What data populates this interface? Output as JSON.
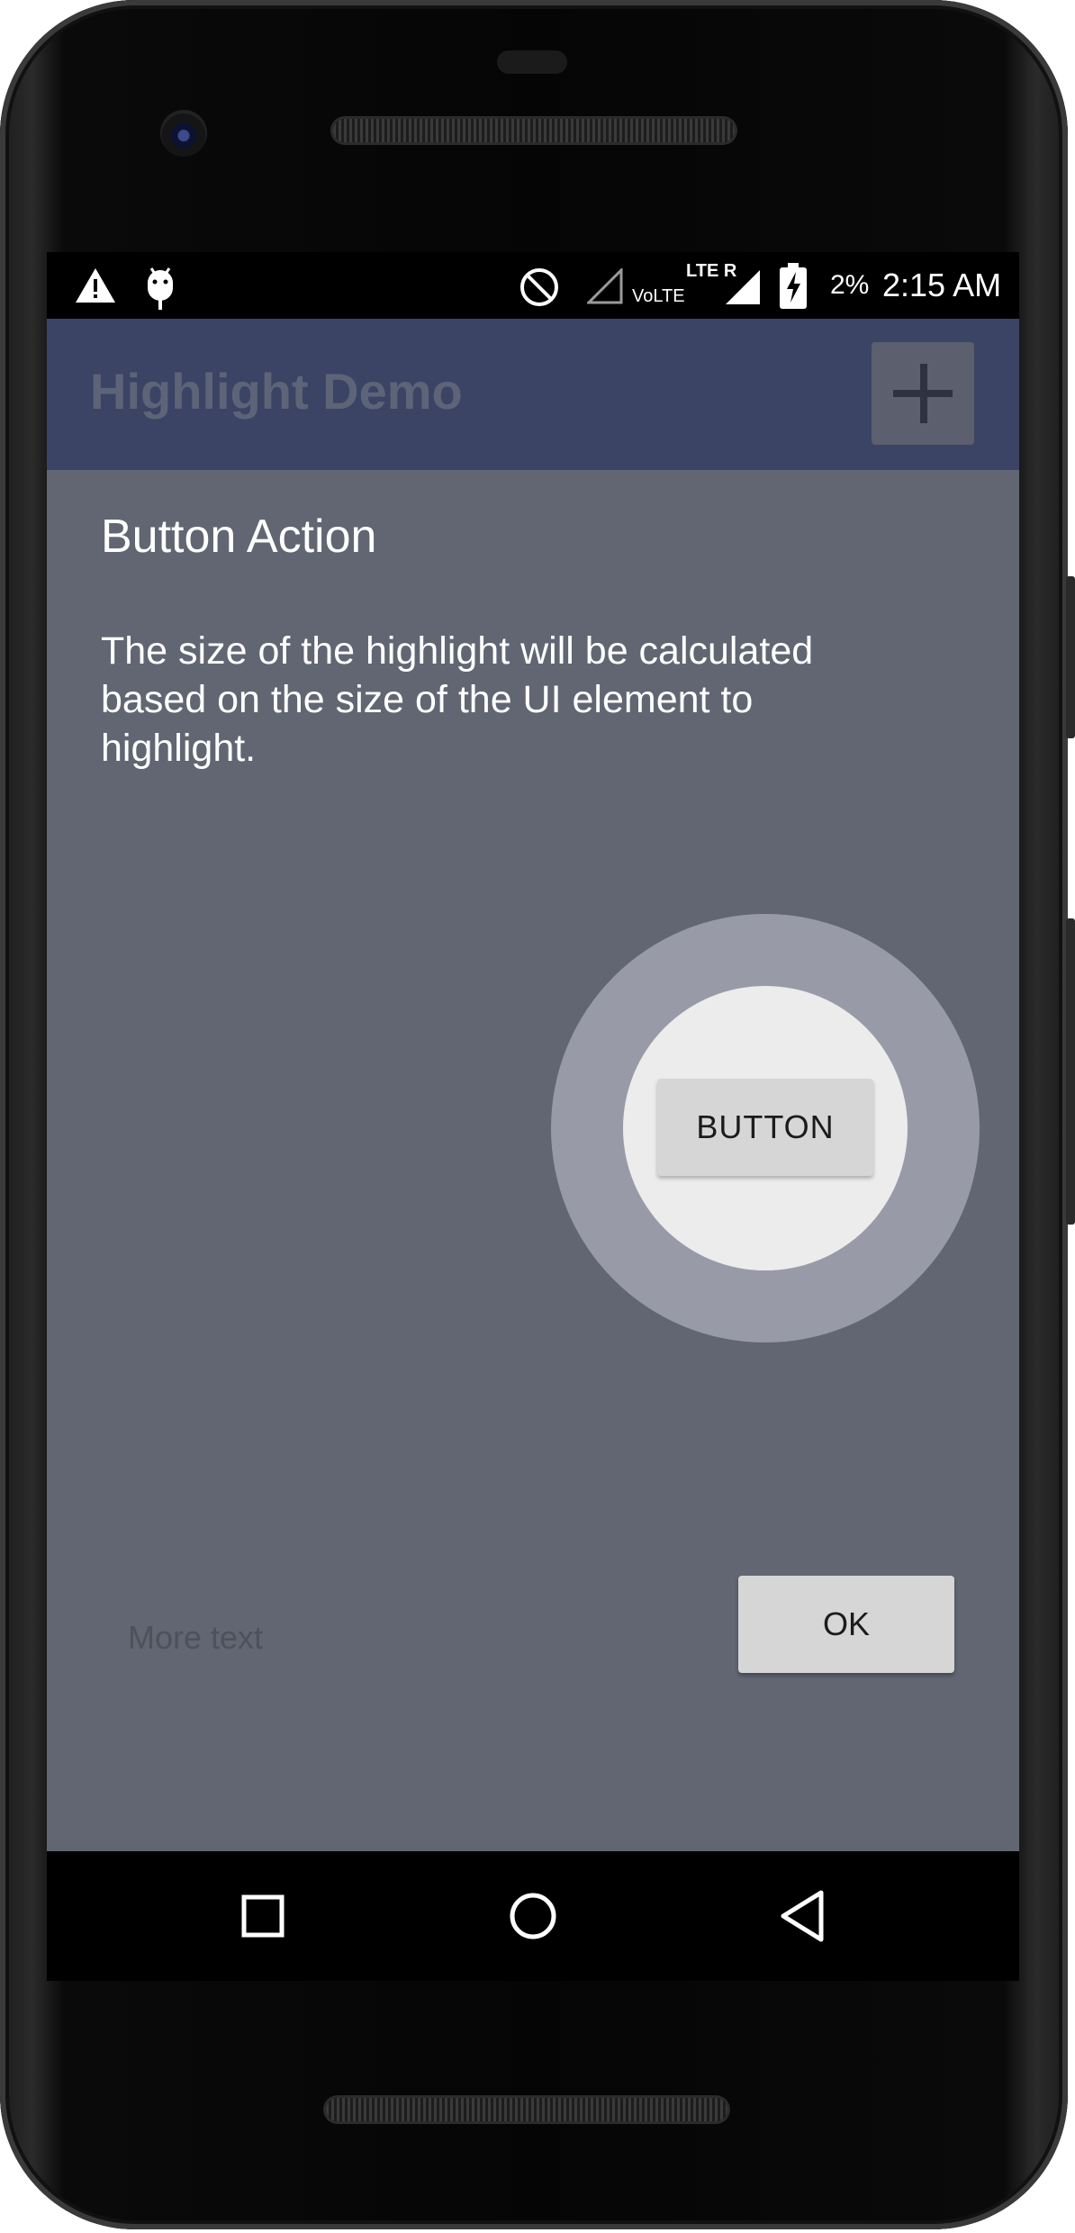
{
  "status_bar": {
    "battery_percent": "2%",
    "time": "2:15 AM",
    "volte_label": "VoLTE",
    "lte_label": "LTE R",
    "icons": [
      "warning-icon",
      "android-debug-icon",
      "do-not-disturb-icon",
      "signal-volte-icon",
      "signal-lte-icon",
      "battery-charging-icon"
    ]
  },
  "app_bar": {
    "title": "Highlight Demo",
    "action_icon": "add-icon"
  },
  "overlay": {
    "title": "Button Action",
    "description": "The size of the highlight will be calculated based on the size of the UI element to highlight.",
    "highlighted_button_label": "BUTTON",
    "more_text": "More text",
    "ok_label": "OK"
  },
  "nav_bar": {
    "items": [
      "recents-icon",
      "home-icon",
      "back-icon"
    ]
  },
  "colors": {
    "app_bar": "#3c4465",
    "scrim": "#616672",
    "halo_outer": "#989ba7",
    "halo_inner": "#ececec",
    "button": "#d6d6d6"
  }
}
